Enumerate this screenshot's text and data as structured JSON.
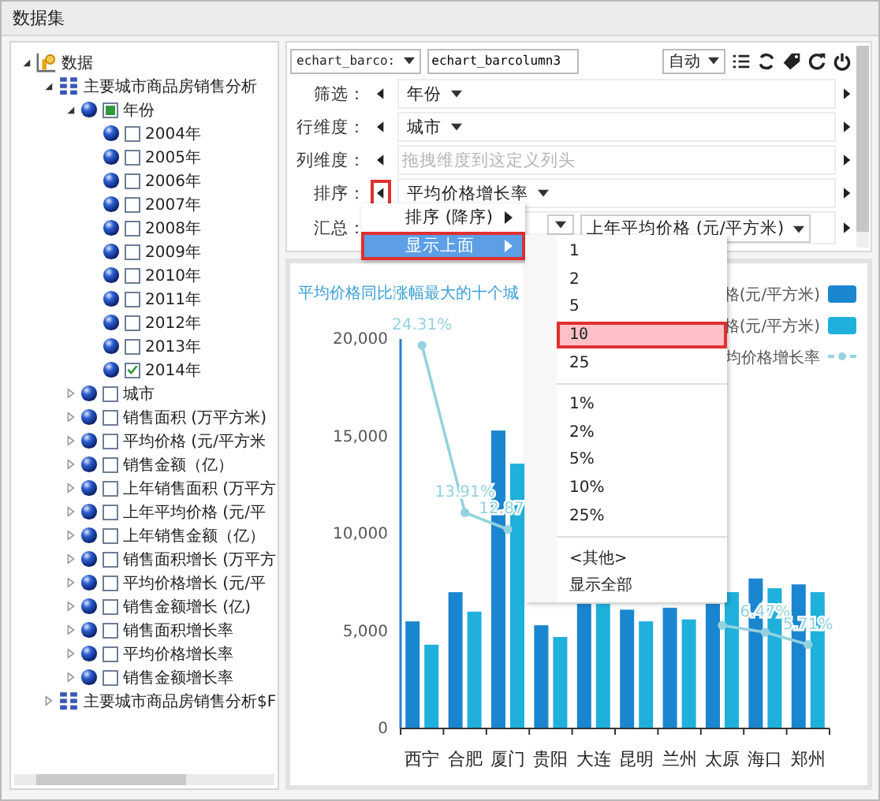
{
  "window": {
    "title": "数据集"
  },
  "tree": [
    {
      "label": "数据",
      "kind": "root",
      "expanded": true,
      "children": [
        {
          "label": "主要城市商品房销售分析",
          "kind": "cube",
          "expanded": true,
          "children": [
            {
              "label": "年份",
              "kind": "field",
              "expanded": true,
              "checked": false,
              "partial": true,
              "children": [
                {
                  "label": "2004年",
                  "kind": "member",
                  "checked": false
                },
                {
                  "label": "2005年",
                  "kind": "member",
                  "checked": false
                },
                {
                  "label": "2006年",
                  "kind": "member",
                  "checked": false
                },
                {
                  "label": "2007年",
                  "kind": "member",
                  "checked": false
                },
                {
                  "label": "2008年",
                  "kind": "member",
                  "checked": false
                },
                {
                  "label": "2009年",
                  "kind": "member",
                  "checked": false
                },
                {
                  "label": "2010年",
                  "kind": "member",
                  "checked": false
                },
                {
                  "label": "2011年",
                  "kind": "member",
                  "checked": false
                },
                {
                  "label": "2012年",
                  "kind": "member",
                  "checked": false
                },
                {
                  "label": "2013年",
                  "kind": "member",
                  "checked": false
                },
                {
                  "label": "2014年",
                  "kind": "member",
                  "checked": true
                }
              ]
            },
            {
              "label": "城市",
              "kind": "field",
              "expanded": false,
              "checked": false,
              "partial": false
            },
            {
              "label": "销售面积 (万平方米)",
              "kind": "field",
              "expanded": false,
              "checked": false,
              "partial": false
            },
            {
              "label": "平均价格 (元/平方米",
              "kind": "field",
              "expanded": false,
              "checked": false,
              "partial": false
            },
            {
              "label": "销售金额（亿）",
              "kind": "field",
              "expanded": false,
              "checked": false,
              "partial": false
            },
            {
              "label": "上年销售面积 (万平方",
              "kind": "field",
              "expanded": false,
              "checked": false,
              "partial": false
            },
            {
              "label": "上年平均价格 (元/平",
              "kind": "field",
              "expanded": false,
              "checked": false,
              "partial": false
            },
            {
              "label": "上年销售金额（亿）",
              "kind": "field",
              "expanded": false,
              "checked": false,
              "partial": false
            },
            {
              "label": "销售面积增长 (万平方",
              "kind": "field",
              "expanded": false,
              "checked": false,
              "partial": false
            },
            {
              "label": "平均价格增长 (元/平",
              "kind": "field",
              "expanded": false,
              "checked": false,
              "partial": false
            },
            {
              "label": "销售金额增长 (亿)",
              "kind": "field",
              "expanded": false,
              "checked": false,
              "partial": false
            },
            {
              "label": "销售面积增长率",
              "kind": "field",
              "expanded": false,
              "checked": false,
              "partial": false
            },
            {
              "label": "平均价格增长率",
              "kind": "field",
              "expanded": false,
              "checked": false,
              "partial": false
            },
            {
              "label": "销售金额增长率",
              "kind": "field",
              "expanded": false,
              "checked": false,
              "partial": false
            }
          ]
        },
        {
          "label": "主要城市商品房销售分析$F",
          "kind": "cube",
          "expanded": false
        }
      ]
    }
  ],
  "toolbar": {
    "dataset_select": "echart_barco:",
    "name_field": "echart_barcolumn3",
    "mode_select": "自动"
  },
  "config_rows": [
    {
      "label": "筛选：",
      "chips": [
        "年份"
      ],
      "marked": false
    },
    {
      "label": "行维度：",
      "chips": [
        "城市"
      ],
      "marked": false
    },
    {
      "label": "列维度：",
      "placeholder": "拖拽维度到这定义列头",
      "marked": false
    },
    {
      "label": "排序：",
      "chips": [
        "平均价格增长率"
      ],
      "marked": true
    },
    {
      "label": "汇总：",
      "covered_chip": true,
      "chips": [
        "上年平均价格 (元/平方米)"
      ]
    }
  ],
  "chart": {
    "bars": {
      "chart_data": {
        "type": "bar",
        "title": "平均价格同比涨幅最大的十个城",
        "categories": [
          "西宁",
          "合肥",
          "厦门",
          "贵阳",
          "大连",
          "昆明",
          "兰州",
          "太原",
          "海口",
          "郑州"
        ],
        "ylim": [
          0,
          20000
        ],
        "yticks": [
          {
            "value": 0,
            "label": "0"
          },
          {
            "value": 5000,
            "label": "5,000"
          },
          {
            "value": 10000,
            "label": "10,000"
          },
          {
            "value": 15000,
            "label": "15,000"
          },
          {
            "value": 20000,
            "label": "20,000"
          }
        ],
        "series": [
          {
            "name": "格(元/平方米)",
            "color": "#1a86d0",
            "values": [
              5500,
              7000,
              15300,
              5300,
              6400,
              6100,
              6200,
              6400,
              7700,
              7400
            ]
          },
          {
            "name": "格(元/平方米)",
            "color": "#1fb0dc",
            "values": [
              4300,
              6000,
              13600,
              4700,
              6400,
              5500,
              5600,
              7000,
              7200,
              7000
            ]
          }
        ]
      }
    },
    "growth": {
      "chart_data": {
        "type": "line",
        "series": [
          {
            "name": "均价格增长率",
            "color": "#94d2de",
            "marker": "circle",
            "values": [
              24.31,
              13.91,
              12.87,
              null,
              null,
              null,
              null,
              6.9,
              6.47,
              5.71
            ],
            "value_labels": [
              "24.31%",
              "13.91%",
              "12.87",
              null,
              null,
              null,
              null,
              null,
              "6.47%",
              "5.71%"
            ]
          }
        ]
      }
    }
  },
  "context_menu": {
    "items": [
      {
        "label": "排序 (降序)",
        "selected": false,
        "marked": false
      },
      {
        "label": "显示上面",
        "selected": true,
        "marked": true
      }
    ]
  },
  "submenu": {
    "groups": [
      [
        {
          "label": "1",
          "selected": false
        },
        {
          "label": "2",
          "selected": false
        },
        {
          "label": "5",
          "selected": false
        },
        {
          "label": "10",
          "selected": true
        },
        {
          "label": "25",
          "selected": false
        }
      ],
      [
        {
          "label": "1%",
          "selected": false
        },
        {
          "label": "2%",
          "selected": false
        },
        {
          "label": "5%",
          "selected": false
        },
        {
          "label": "10%",
          "selected": false
        },
        {
          "label": "25%",
          "selected": false
        }
      ],
      [
        {
          "label": "<其他>",
          "selected": false
        },
        {
          "label": "显示全部",
          "selected": false
        }
      ]
    ]
  }
}
